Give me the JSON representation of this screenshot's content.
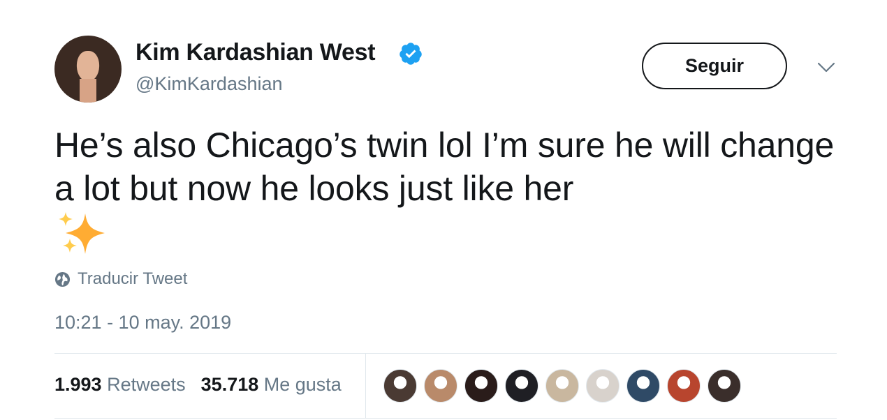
{
  "user": {
    "display_name": "Kim Kardashian West",
    "handle": "@KimKardashian",
    "verified": true,
    "avatar_icon": "profile-photo"
  },
  "follow_button": {
    "label": "Seguir"
  },
  "menu_icon": "chevron-down-icon",
  "tweet": {
    "text": "He’s also Chicago’s twin lol I’m sure he will change a lot but now he looks just like her",
    "emoji": "✨"
  },
  "translate": {
    "label": "Traducir Tweet",
    "icon": "globe-icon"
  },
  "timestamp": "10:21 - 10 may. 2019",
  "stats": {
    "retweets": {
      "count": "1.993",
      "label": "Retweets"
    },
    "likes": {
      "count": "35.718",
      "label": "Me gusta"
    }
  },
  "likers": [
    {
      "color": "#4a3a33"
    },
    {
      "color": "#b98a6a"
    },
    {
      "color": "#2a1c1a"
    },
    {
      "color": "#1f1f24"
    },
    {
      "color": "#c9b79f"
    },
    {
      "color": "#d8d2cc"
    },
    {
      "color": "#2f4a66"
    },
    {
      "color": "#b8452e"
    },
    {
      "color": "#3a2e2b"
    }
  ],
  "colors": {
    "text": "#14171a",
    "secondary": "#657786",
    "verified": "#1da1f2",
    "border": "#e1e8ed",
    "sparkle": "#ffac33"
  }
}
